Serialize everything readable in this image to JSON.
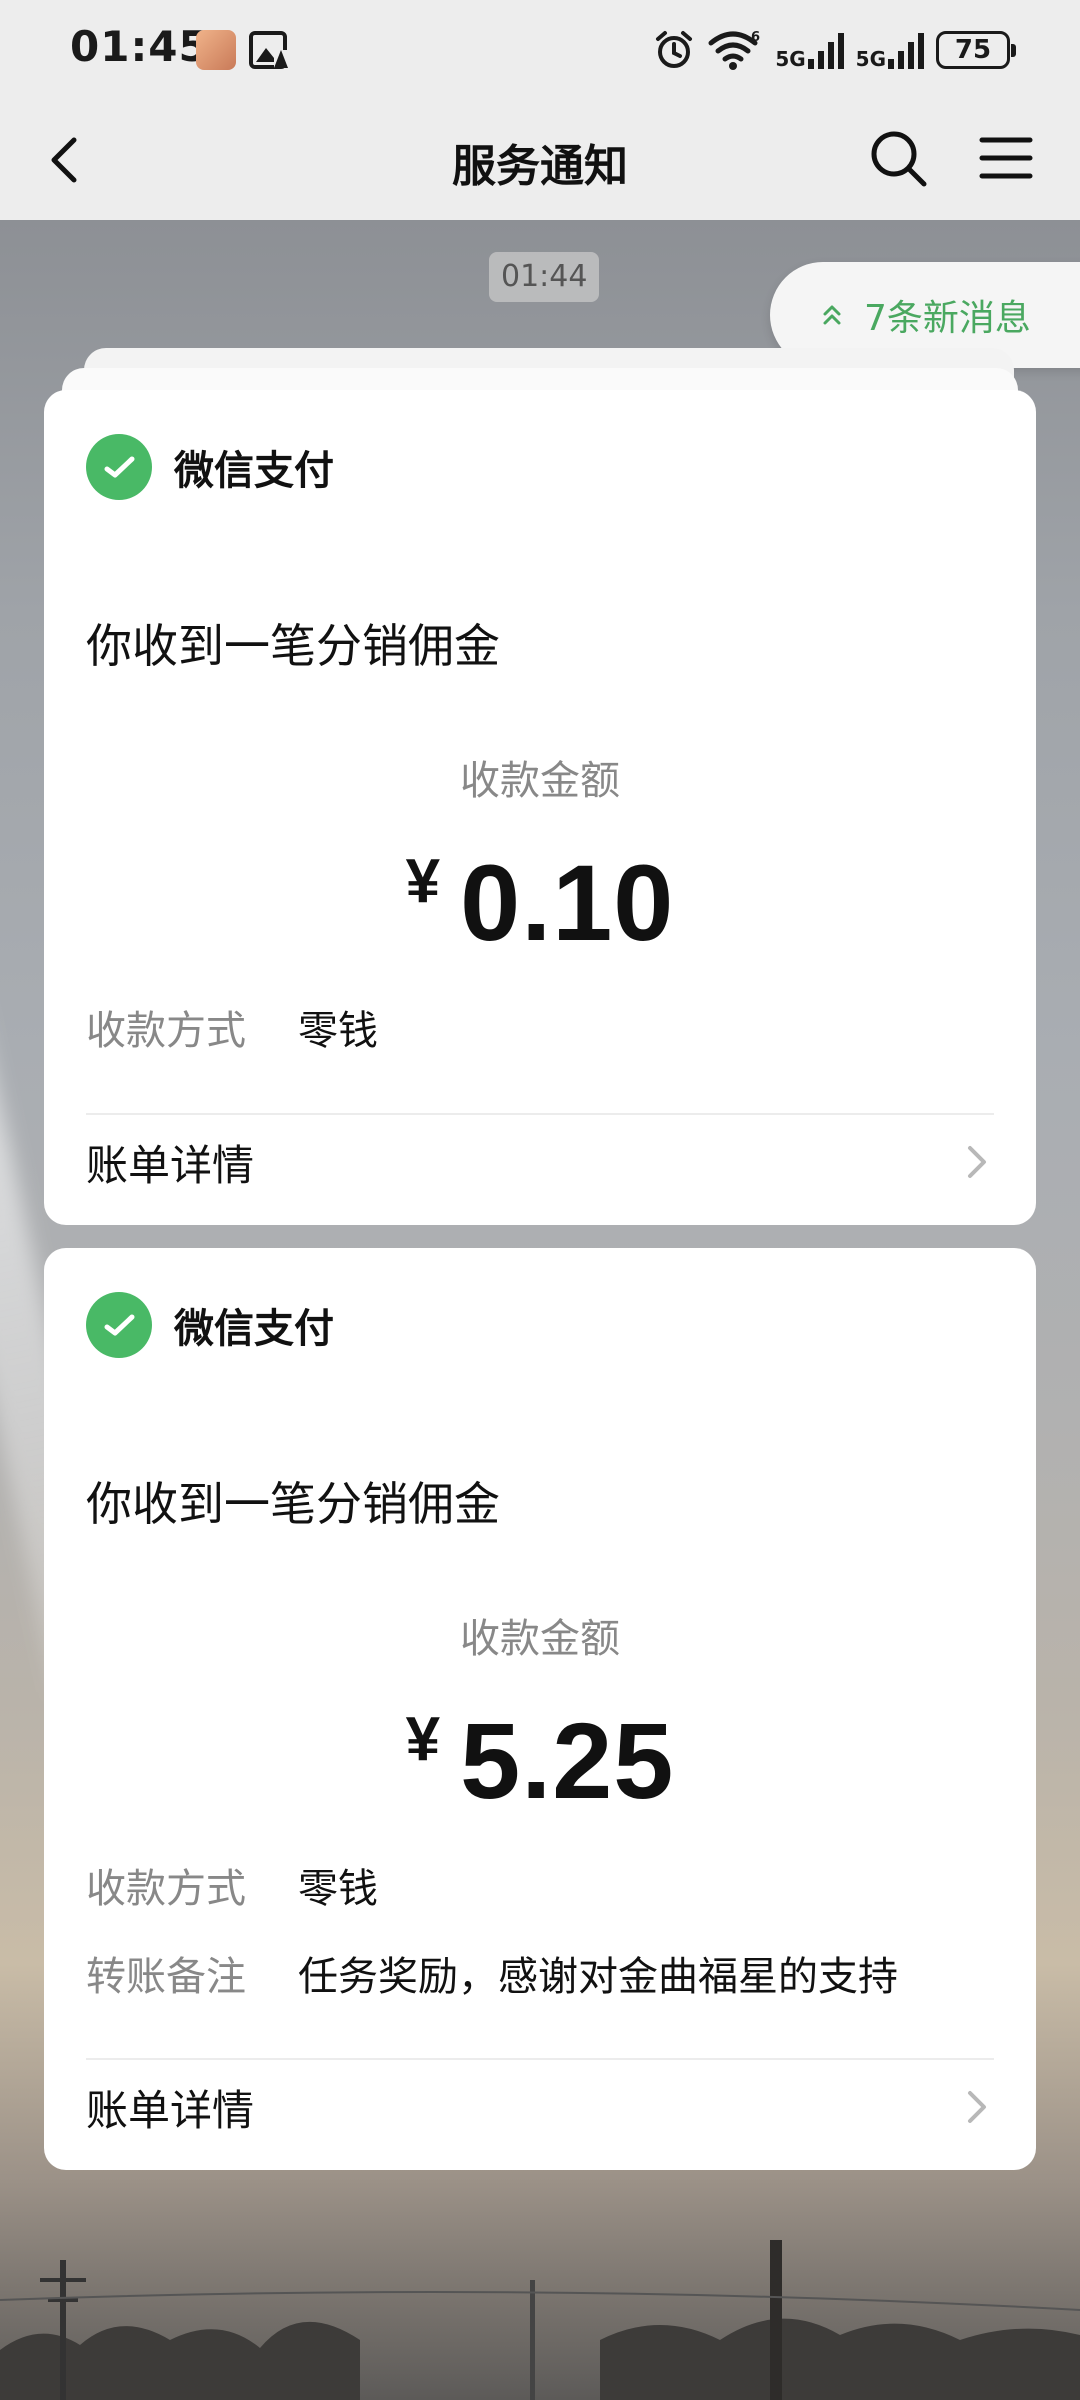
{
  "status_bar": {
    "time": "01:45",
    "network_1": "5G",
    "network_2": "5G",
    "wifi_label": "6",
    "battery": "75"
  },
  "nav": {
    "title": "服务通知",
    "back_icon": "chevron-left-icon",
    "search_icon": "search-icon",
    "menu_icon": "menu-icon"
  },
  "chat": {
    "timestamp": "01:44",
    "new_messages": "7条新消息"
  },
  "cards": [
    {
      "source": "微信支付",
      "title": "你收到一笔分销佣金",
      "amount_label": "收款金额",
      "currency": "¥",
      "amount": "0.10",
      "rows": [
        {
          "key": "收款方式",
          "value": "零钱"
        }
      ],
      "detail_label": "账单详情"
    },
    {
      "source": "微信支付",
      "title": "你收到一笔分销佣金",
      "amount_label": "收款金额",
      "currency": "¥",
      "amount": "5.25",
      "rows": [
        {
          "key": "收款方式",
          "value": "零钱"
        },
        {
          "key": "转账备注",
          "value": "任务奖励，感谢对金曲福星的支持"
        }
      ],
      "detail_label": "账单详情"
    }
  ],
  "colors": {
    "accent_green": "#49b966",
    "new_msg_green": "#4aa860",
    "nav_bg": "#ededed"
  }
}
